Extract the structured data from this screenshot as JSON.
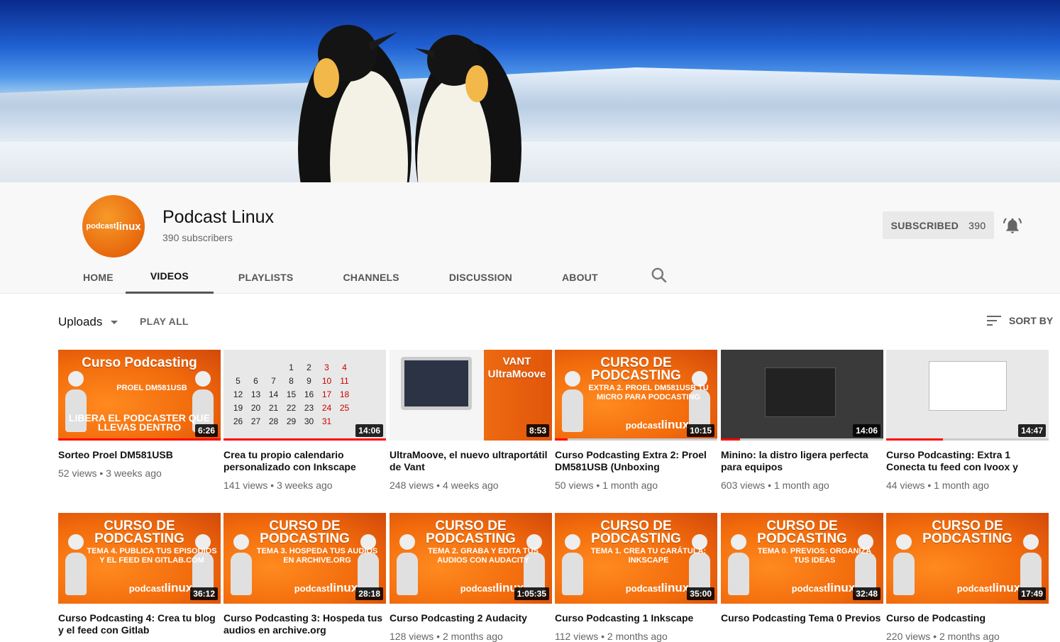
{
  "channel": {
    "name": "Podcast Linux",
    "subscribers_text": "390 subscribers",
    "avatar_text": "podcast",
    "avatar_text_bold": "linux"
  },
  "subscribe": {
    "label": "SUBSCRIBED",
    "count": "390"
  },
  "tabs": [
    {
      "label": "HOME",
      "active": false
    },
    {
      "label": "VIDEOS",
      "active": true
    },
    {
      "label": "PLAYLISTS",
      "active": false
    },
    {
      "label": "CHANNELS",
      "active": false
    },
    {
      "label": "DISCUSSION",
      "active": false
    },
    {
      "label": "ABOUT",
      "active": false
    }
  ],
  "toolbar": {
    "uploads_label": "Uploads",
    "play_all_label": "PLAY ALL",
    "sort_label": "SORT BY"
  },
  "videos": [
    {
      "title": "Sorteo Proel DM581USB",
      "views": "52 views",
      "age": "3 weeks ago",
      "duration": "6:26",
      "style": "orange",
      "thumb_line1": "Curso Podcasting",
      "thumb_line2": "PROEL DM581USB",
      "thumb_line3": "LIBERA EL PODCASTER QUE LLEVAS DENTRO",
      "progress": 1.0
    },
    {
      "title": "Crea tu propio calendario personalizado con Inkscape",
      "views": "141 views",
      "age": "3 weeks ago",
      "duration": "14:06",
      "style": "calendar",
      "thumb_line1": "",
      "thumb_line2": "",
      "thumb_line3": "",
      "progress": 1.0
    },
    {
      "title": "UltraMoove, el nuevo ultraportátil de Vant",
      "views": "248 views",
      "age": "4 weeks ago",
      "duration": "8:53",
      "style": "laptop",
      "thumb_line1": "VANT UltraMoove",
      "thumb_line2": "",
      "thumb_line3": "",
      "progress": 0
    },
    {
      "title": "Curso Podcasting Extra 2: Proel DM581USB (Unboxing",
      "views": "50 views",
      "age": "1 month ago",
      "duration": "10:15",
      "style": "orange",
      "thumb_line1": "CURSO DE PODCASTING",
      "thumb_line2": "EXTRA 2. PROEL DM581USB TU MICRO PARA PODCASTING",
      "thumb_line3": "",
      "progress": 0.08
    },
    {
      "title": "Minino: la distro ligera perfecta para equipos",
      "views": "603 views",
      "age": "1 month ago",
      "duration": "14:06",
      "style": "dark",
      "thumb_line1": "",
      "thumb_line2": "",
      "thumb_line3": "",
      "progress": 0.12
    },
    {
      "title": "Curso Podcasting: Extra 1 Conecta tu feed con Ivoox y",
      "views": "44 views",
      "age": "1 month ago",
      "duration": "14:47",
      "style": "screen",
      "thumb_line1": "",
      "thumb_line2": "",
      "thumb_line3": "",
      "progress": 0.35
    },
    {
      "title": "Curso Podcasting 4: Crea tu blog y el feed con Gitlab",
      "views": "",
      "age": "",
      "duration": "36:12",
      "style": "orange",
      "thumb_line1": "CURSO DE PODCASTING",
      "thumb_line2": "TEMA 4. PUBLICA TUS EPISODIOS Y EL FEED EN GITLAB.COM",
      "thumb_line3": "",
      "progress": 0
    },
    {
      "title": "Curso Podcasting 3: Hospeda tus audios en archive.org",
      "views": "",
      "age": "",
      "duration": "28:18",
      "style": "orange",
      "thumb_line1": "CURSO DE PODCASTING",
      "thumb_line2": "TEMA 3. HOSPEDA TUS AUDIOS EN ARCHIVE.ORG",
      "thumb_line3": "",
      "progress": 0
    },
    {
      "title": "Curso Podcasting 2 Audacity",
      "views": "128 views",
      "age": "2 months ago",
      "duration": "1:05:35",
      "style": "orange",
      "thumb_line1": "CURSO DE PODCASTING",
      "thumb_line2": "TEMA 2. GRABA Y EDITA TUS AUDIOS CON AUDACITY",
      "thumb_line3": "",
      "progress": 0
    },
    {
      "title": "Curso Podcasting 1 Inkscape",
      "views": "112 views",
      "age": "2 months ago",
      "duration": "35:00",
      "style": "orange",
      "thumb_line1": "CURSO DE PODCASTING",
      "thumb_line2": "TEMA 1. CREA TU CARÁTULA: INKSCAPE",
      "thumb_line3": "",
      "progress": 0
    },
    {
      "title": "Curso Podcasting Tema 0 Previos",
      "views": "",
      "age": "",
      "duration": "32:48",
      "style": "orange",
      "thumb_line1": "CURSO DE PODCASTING",
      "thumb_line2": "TEMA 0. PREVIOS: ORGANIZA TUS IDEAS",
      "thumb_line3": "",
      "progress": 0
    },
    {
      "title": "Curso de Podcasting",
      "views": "220 views",
      "age": "2 months ago",
      "duration": "17:49",
      "style": "orange",
      "thumb_line1": "CURSO DE PODCASTING",
      "thumb_line2": "",
      "thumb_line3": "",
      "progress": 0
    }
  ],
  "thumb_brand": {
    "text": "podcast",
    "bold": "linux"
  },
  "calendar_rows": [
    [
      "",
      "",
      "",
      "1",
      "2",
      "3",
      "4"
    ],
    [
      "5",
      "6",
      "7",
      "8",
      "9",
      "10",
      "11"
    ],
    [
      "12",
      "13",
      "14",
      "15",
      "16",
      "17",
      "18"
    ],
    [
      "19",
      "20",
      "21",
      "22",
      "23",
      "24",
      "25"
    ],
    [
      "26",
      "27",
      "28",
      "29",
      "30",
      "31",
      ""
    ]
  ],
  "colors": {
    "accent_orange": "#f26b0c",
    "progress_red": "#ff0000"
  }
}
